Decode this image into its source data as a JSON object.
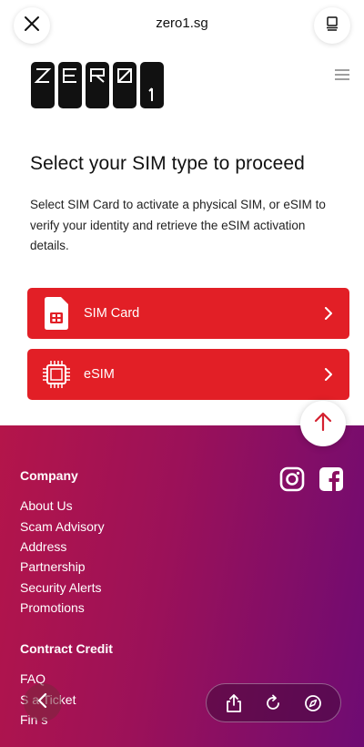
{
  "browser": {
    "url": "zero1.sg",
    "close_icon": "close-icon",
    "tabs_icon": "tabs-icon"
  },
  "header": {
    "logo_text": "ZERO1",
    "menu_icon": "hamburger-icon"
  },
  "main": {
    "title": "Select your SIM type to proceed",
    "description": "Select SIM Card to activate a physical SIM, or eSIM to verify your identity and retrieve the eSIM activation details.",
    "options": [
      {
        "label": "SIM Card",
        "icon": "sim-card-icon"
      },
      {
        "label": "eSIM",
        "icon": "chip-icon"
      }
    ],
    "accent_color": "#e21f26"
  },
  "scroll_top_icon": "arrow-up-icon",
  "footer": {
    "company_heading": "Company",
    "company_links": [
      "About Us",
      "Scam Advisory",
      "Address",
      "Partnership",
      "Security Alerts",
      "Promotions"
    ],
    "contract_heading": "Contract Credit",
    "contract_links": [
      "FAQ",
      "S a Ticket",
      "Fin s"
    ],
    "social_icons": [
      "instagram-icon",
      "facebook-icon"
    ]
  },
  "browser_toolbar": {
    "icons": [
      "back-icon",
      "share-icon",
      "reload-icon",
      "compass-icon"
    ]
  }
}
